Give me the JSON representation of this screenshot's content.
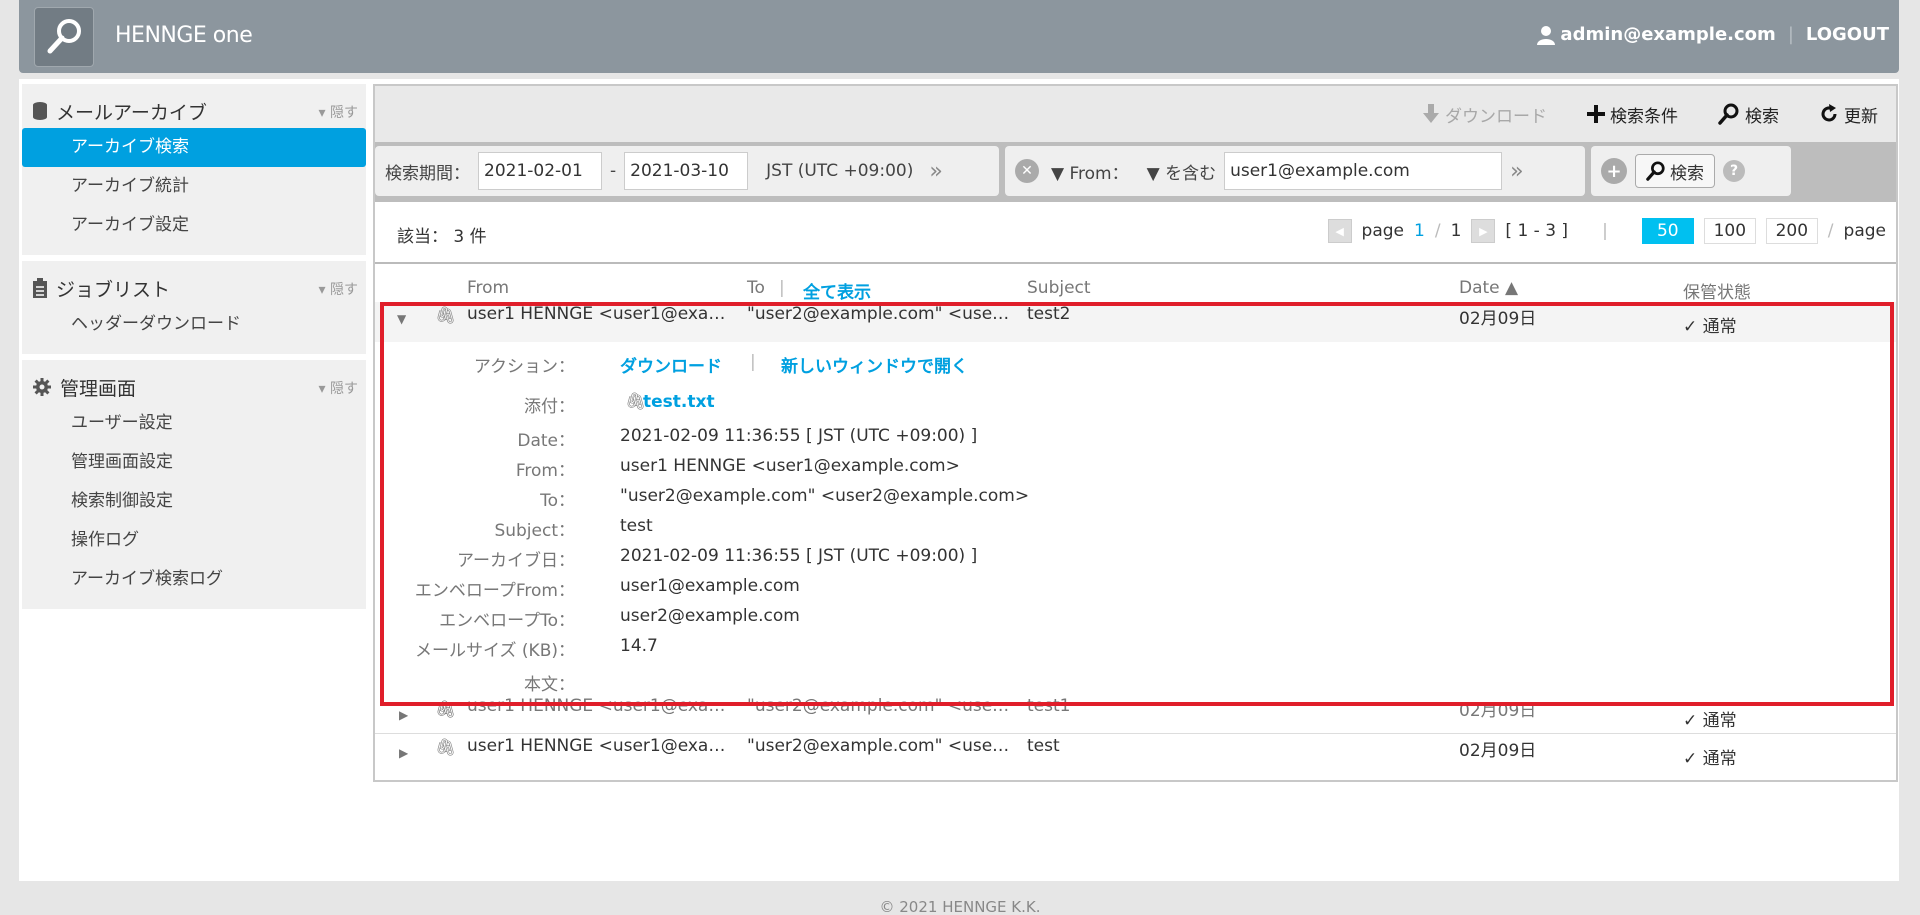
{
  "header": {
    "brand": "HENNGE one",
    "user": "admin@example.com",
    "separator": "|",
    "logout": "LOGOUT"
  },
  "sidebar": {
    "hide_label": "▾ 隠す",
    "sections": [
      {
        "title": "メールアーカイブ",
        "items": [
          "アーカイブ検索",
          "アーカイブ統計",
          "アーカイブ設定"
        ]
      },
      {
        "title": "ジョブリスト",
        "items": [
          "ヘッダーダウンロード"
        ]
      },
      {
        "title": "管理画面",
        "items": [
          "ユーザー設定",
          "管理画面設定",
          "検索制御設定",
          "操作ログ",
          "アーカイブ検索ログ"
        ]
      }
    ]
  },
  "toolbar": {
    "download": "ダウンロード",
    "criteria": "検索条件",
    "search": "検索",
    "refresh": "更新"
  },
  "filter": {
    "period_label": "検索期間：",
    "date_from": "2021-02-01",
    "dash": "-",
    "date_to": "2021-03-10",
    "timezone": "JST (UTC +09:00)",
    "field": "▼ From：",
    "operator": "▼ を含む",
    "value": "user1@example.com",
    "search_button": "検索"
  },
  "results": {
    "count_label": "該当：",
    "count": "3 件",
    "page_word": "page",
    "page_current": "1",
    "page_sep": "/",
    "page_total": "1",
    "range": "[ 1 - 3 ]",
    "divider": "|",
    "sizes": [
      "50",
      "100",
      "200"
    ],
    "page_suffix": "page"
  },
  "columns": {
    "from": "From",
    "to": "To",
    "to_sep": "|",
    "show_all": "全て表示",
    "subject": "Subject",
    "date": "Date ▲",
    "status": "保管状態"
  },
  "rows": [
    {
      "from": "user1 HENNGE <user1@exa…",
      "to": "\"user2@example.com\" <use…",
      "subject": "test2",
      "date": "02月09日",
      "status": "✓ 通常"
    },
    {
      "from": "user1 HENNGE <user1@exa…",
      "to": "\"user2@example.com\" <use…",
      "subject": "test1",
      "date": "02月09日",
      "status": "✓ 通常"
    },
    {
      "from": "user1 HENNGE <user1@exa…",
      "to": "\"user2@example.com\" <use…",
      "subject": "test",
      "date": "02月09日",
      "status": "✓ 通常"
    }
  ],
  "detail": {
    "action_label": "アクション：",
    "action_download": "ダウンロード",
    "action_sep": "|",
    "action_open": "新しいウィンドウで開く",
    "attach_label": "添付：",
    "attach_file": "test.txt",
    "fields": [
      {
        "label": "Date：",
        "value": "2021-02-09 11:36:55 [ JST (UTC +09:00) ]"
      },
      {
        "label": "From：",
        "value": "user1 HENNGE <user1@example.com>"
      },
      {
        "label": "To：",
        "value": "\"user2@example.com\" <user2@example.com>"
      },
      {
        "label": "Subject：",
        "value": "test"
      },
      {
        "label": "アーカイブ日：",
        "value": "2021-02-09 11:36:55 [ JST (UTC +09:00) ]"
      },
      {
        "label": "エンベロープFrom：",
        "value": "user1@example.com"
      },
      {
        "label": "エンベロープTo：",
        "value": "user2@example.com"
      },
      {
        "label": "メールサイズ (KB)：",
        "value": "14.7"
      },
      {
        "label": "本文：",
        "value": ""
      }
    ]
  },
  "footer": {
    "copyright": "© 2021 HENNGE K.K."
  },
  "colors": {
    "accent": "#00a0e0",
    "highlight": "#e01e2a",
    "header": "#8c969e"
  }
}
